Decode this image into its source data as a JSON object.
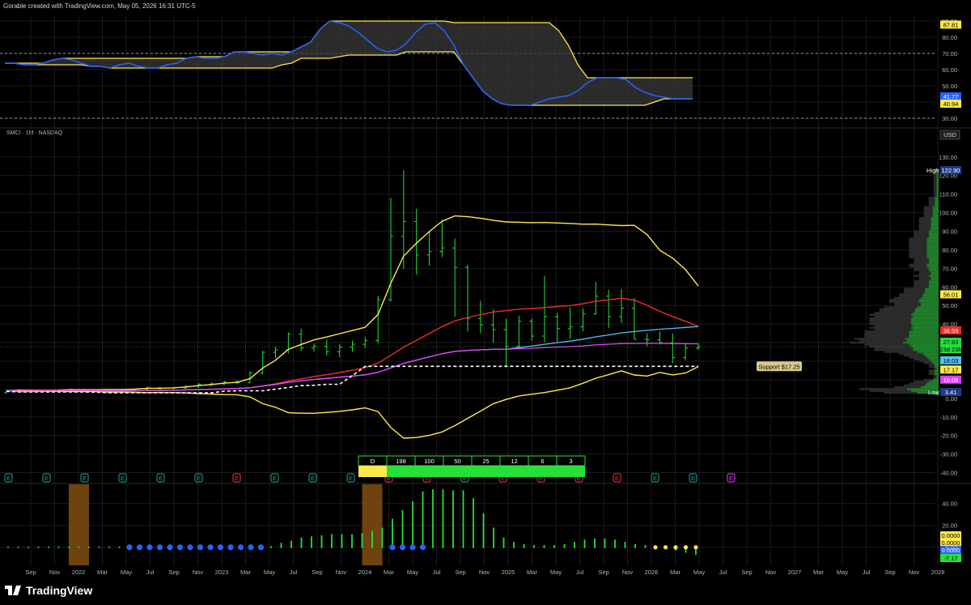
{
  "header": {
    "text": "Gorable created with TradingView.com, May 05, 2026 16:31 UTC-5"
  },
  "symbol": {
    "text": "SMCI · 1M · NASDAQ"
  },
  "brand": {
    "text": "TradingView"
  },
  "currency": "USD",
  "support_label": "Support $17.25",
  "months": [
    "Sep",
    "Nov",
    "2022",
    "Mar",
    "May",
    "Jul",
    "Sep",
    "Nov",
    "2023",
    "Mar",
    "May",
    "Jul",
    "Sep",
    "Nov",
    "2024",
    "Mar",
    "May",
    "Jul",
    "Sep",
    "Nov",
    "2025",
    "Mar",
    "May",
    "Jul",
    "Sep",
    "Nov",
    "2026",
    "Mar",
    "May",
    "Jul",
    "Sep",
    "Nov",
    "2027",
    "Mar",
    "May",
    "Jul",
    "Sep",
    "Nov",
    "2028"
  ],
  "colors": {
    "green": "#26e03a",
    "yellow": "#ffe84a",
    "red": "#f22b2b",
    "blue": "#2962ff",
    "cyan": "#4fc3f7",
    "magenta": "#e040fb",
    "brown": "#7a4a12",
    "grid": "#1b1b1b"
  },
  "chart_data": [
    {
      "type": "line",
      "panel": "oscillator",
      "yticks": [
        90,
        80,
        70,
        60,
        50,
        40,
        30
      ],
      "ylim": [
        27,
        92
      ],
      "dashed_levels": [
        70,
        30
      ],
      "series": [],
      "value_tags": [
        {
          "value": "87.81",
          "bg": "#ffe84a",
          "fg": "#000"
        },
        {
          "value": "41.77",
          "bg": "#2962ff",
          "fg": "#fff"
        },
        {
          "value": "40.94",
          "bg": "#ffe84a",
          "fg": "#000"
        }
      ],
      "blue_line": [
        64,
        64,
        63,
        63,
        64,
        66,
        67,
        66,
        64,
        62,
        62,
        61,
        63,
        64,
        62,
        61,
        61,
        63,
        64,
        67,
        68,
        67,
        67,
        68,
        71,
        71,
        70,
        69,
        70,
        69,
        71,
        74,
        77,
        85,
        90,
        89,
        87,
        83,
        78,
        73,
        71,
        72,
        76,
        83,
        88,
        89,
        84,
        75,
        63,
        55,
        47,
        42,
        39,
        38,
        38,
        38,
        40,
        42,
        43,
        44,
        47,
        52,
        55,
        55,
        55,
        54,
        49,
        46,
        44,
        43,
        42,
        42,
        42
      ]
    },
    {
      "type": "ohlc",
      "panel": "price",
      "yticks": [
        130,
        120,
        110,
        100,
        90,
        80,
        70,
        60,
        50,
        40,
        30,
        20,
        10,
        0,
        -10,
        -20,
        -30,
        -40
      ],
      "ylim": [
        -45,
        136
      ],
      "high_label": "High",
      "high_value": "122.90",
      "low_label": "Low",
      "low_value": "3.41",
      "value_tags": [
        {
          "value": "56.01",
          "bg": "#ffe84a",
          "fg": "#000"
        },
        {
          "value": "36.59",
          "bg": "#f22b2b",
          "fg": "#fff"
        },
        {
          "value": "27.83",
          "bg": "#26e03a",
          "fg": "#000"
        },
        {
          "value": "23d 23h",
          "bg": "#26e03a",
          "fg": "#000"
        },
        {
          "value": "18.03",
          "bg": "#4fc3f7",
          "fg": "#000"
        },
        {
          "value": "17.17",
          "bg": "#ffe84a",
          "fg": "#000"
        },
        {
          "value": "10.06",
          "bg": "#e040fb",
          "fg": "#fff"
        }
      ],
      "support": 17.25,
      "bars": [
        [
          3.0,
          4.8,
          2.6,
          4.2
        ],
        [
          4.2,
          4.9,
          3.4,
          3.8
        ],
        [
          3.8,
          4.6,
          3.3,
          4.1
        ],
        [
          4.1,
          4.8,
          3.6,
          4.0
        ],
        [
          4.0,
          4.7,
          3.5,
          4.3
        ],
        [
          4.3,
          5.2,
          3.9,
          4.6
        ],
        [
          4.6,
          5.1,
          3.8,
          4.2
        ],
        [
          4.2,
          4.9,
          3.4,
          3.7
        ],
        [
          3.7,
          4.4,
          3.0,
          3.3
        ],
        [
          3.3,
          4.6,
          3.1,
          4.3
        ],
        [
          4.3,
          5.3,
          3.9,
          4.9
        ],
        [
          4.9,
          6.3,
          4.4,
          5.7
        ],
        [
          5.7,
          6.1,
          4.1,
          4.5
        ],
        [
          4.5,
          5.9,
          4.1,
          5.5
        ],
        [
          5.5,
          7.1,
          5.1,
          6.5
        ],
        [
          6.5,
          8.1,
          5.6,
          7.6
        ],
        [
          7.6,
          8.6,
          6.6,
          7.8
        ],
        [
          7.8,
          9.3,
          7.1,
          8.8
        ],
        [
          8.8,
          9.9,
          7.6,
          8.4
        ],
        [
          8.4,
          14.5,
          8.1,
          13.6
        ],
        [
          13.6,
          25.6,
          13.1,
          24.8
        ],
        [
          24.8,
          27.8,
          21.5,
          26.1
        ],
        [
          26.1,
          35.6,
          24.1,
          34.5
        ],
        [
          34.5,
          37.6,
          25.6,
          27.1
        ],
        [
          27.1,
          29.5,
          25.1,
          28.1
        ],
        [
          28.1,
          31.6,
          23.1,
          25.1
        ],
        [
          25.1,
          29.1,
          22.1,
          27.6
        ],
        [
          27.6,
          31.1,
          25.1,
          29.1
        ],
        [
          29.1,
          33.1,
          27.1,
          31.1
        ],
        [
          31.1,
          55.2,
          29.6,
          53.1
        ],
        [
          53.1,
          108.0,
          52.1,
          87.2
        ],
        [
          87.2,
          122.9,
          69.6,
          95.2
        ],
        [
          95.2,
          102.1,
          66.6,
          77.2
        ],
        [
          77.2,
          90.0,
          71.5,
          79.0
        ],
        [
          79.0,
          96.2,
          76.0,
          81.0
        ],
        [
          81.0,
          86.0,
          44.0,
          70.5
        ],
        [
          70.5,
          72.0,
          36.0,
          43.0
        ],
        [
          43.0,
          52.5,
          35.0,
          39.5
        ],
        [
          39.5,
          48.0,
          30.0,
          37.0
        ],
        [
          37.0,
          43.0,
          17.2,
          28.0
        ],
        [
          28.0,
          44.5,
          26.3,
          41.5
        ],
        [
          41.5,
          43.0,
          31.0,
          33.5
        ],
        [
          33.5,
          66.0,
          30.1,
          44.0
        ],
        [
          44.0,
          46.0,
          30.0,
          37.5
        ],
        [
          37.5,
          49.0,
          32.0,
          38.5
        ],
        [
          38.5,
          48.5,
          36.0,
          45.5
        ],
        [
          45.5,
          62.8,
          45.0,
          55.0
        ],
        [
          55.0,
          58.5,
          38.0,
          44.0
        ],
        [
          44.0,
          59.0,
          40.5,
          48.5
        ],
        [
          48.5,
          54.0,
          31.5,
          31.8
        ],
        [
          31.8,
          35.0,
          28.0,
          31.5
        ],
        [
          31.5,
          36.0,
          29.0,
          30.0
        ],
        [
          30.0,
          35.0,
          19.0,
          22.0
        ],
        [
          22.0,
          29.5,
          20.5,
          27.0
        ],
        [
          27.0,
          29.5,
          26.0,
          27.8
        ]
      ]
    },
    {
      "type": "bar",
      "panel": "histogram",
      "yticks": [
        40,
        20,
        0
      ],
      "ylim": [
        -12,
        56
      ],
      "value_tags": [
        {
          "value": "0.0000",
          "bg": "#ffe84a",
          "fg": "#000"
        },
        {
          "value": "0.0000",
          "bg": "#ffe84a",
          "fg": "#000"
        },
        {
          "value": "0.0000",
          "bg": "#2962ff",
          "fg": "#fff"
        },
        {
          "value": "-7.17",
          "bg": "#26e03a",
          "fg": "#000"
        }
      ],
      "values": [
        0,
        0,
        0,
        0,
        0,
        0,
        0,
        0,
        0,
        0,
        0,
        0,
        0,
        0,
        0,
        0,
        0,
        0,
        0,
        0,
        0,
        0,
        0,
        0,
        0,
        0,
        1,
        4,
        6,
        9,
        10,
        11,
        12,
        12,
        12,
        13,
        15,
        18,
        26,
        34,
        42,
        51,
        53,
        53,
        52,
        52,
        45,
        31,
        18,
        9,
        5,
        3,
        2,
        2,
        2,
        3,
        5,
        7,
        8,
        8,
        7,
        5,
        3,
        2,
        0,
        0,
        -3,
        -5,
        -7
      ],
      "dot_colors": [
        "g",
        "g",
        "g",
        "g",
        "g",
        "g",
        "g",
        "g",
        "g",
        "g",
        "g",
        "g",
        "b",
        "b",
        "b",
        "b",
        "b",
        "b",
        "b",
        "b",
        "b",
        "b",
        "b",
        "b",
        "b",
        "b",
        "g",
        "g",
        "g",
        "g",
        "g",
        "g",
        "g",
        "g",
        "g",
        "g",
        "g",
        "g",
        "b",
        "b",
        "b",
        "b",
        "g",
        "g",
        "g",
        "g",
        "g",
        "g",
        "g",
        "g",
        "g",
        "g",
        "g",
        "g",
        "g",
        "g",
        "g",
        "g",
        "g",
        "g",
        "g",
        "g",
        "g",
        "g",
        "y",
        "y",
        "y",
        "y",
        "y"
      ],
      "shaded_months": [
        [
          5,
          6
        ],
        [
          27.5,
          29.5
        ]
      ]
    }
  ],
  "table": {
    "headers": [
      "D",
      "198",
      "100",
      "50",
      "25",
      "12",
      "6",
      "3"
    ],
    "states": [
      "yellow",
      "green",
      "green",
      "green",
      "green",
      "green",
      "green",
      "green"
    ]
  },
  "earnings_markers": [
    {
      "label": "E",
      "color": "#26a69a"
    },
    {
      "label": "E",
      "color": "#26a69a"
    },
    {
      "label": "E",
      "color": "#26a69a"
    },
    {
      "label": "E",
      "color": "#26a69a"
    },
    {
      "label": "E",
      "color": "#26a69a"
    },
    {
      "label": "E",
      "color": "#26a69a"
    },
    {
      "label": "E",
      "color": "#f23645"
    },
    {
      "label": "E",
      "color": "#26a69a"
    },
    {
      "label": "E",
      "color": "#26a69a"
    },
    {
      "label": "E",
      "color": "#26a69a"
    },
    {
      "label": "E",
      "color": "#f23645"
    },
    {
      "label": "S",
      "color": "#f23645"
    },
    {
      "label": "E",
      "color": "#26a69a"
    },
    {
      "label": "E",
      "color": "#f23645"
    },
    {
      "label": "E",
      "color": "#f23645"
    },
    {
      "label": "E",
      "color": "#f23645"
    },
    {
      "label": "E",
      "color": "#f23645"
    },
    {
      "label": "E",
      "color": "#26a69a"
    },
    {
      "label": "E",
      "color": "#26a69a"
    },
    {
      "label": "E",
      "color": "#e040fb"
    }
  ]
}
